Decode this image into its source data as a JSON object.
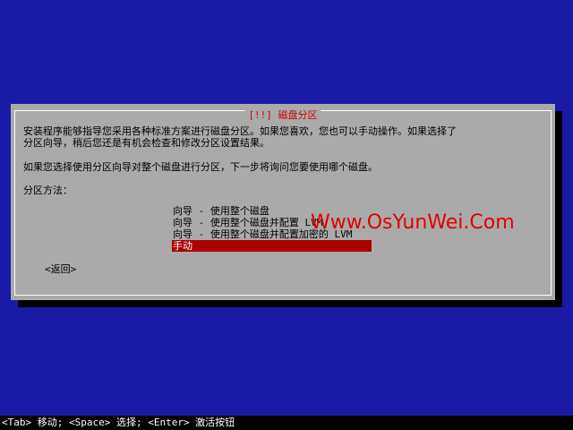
{
  "dialog": {
    "title": "[!!] 磁盘分区",
    "intro_line1": "安装程序能够指导您采用各种标准方案进行磁盘分区。如果您喜欢，您也可以手动操作。如果选择了",
    "intro_line2": "分区向导，稍后您还是有机会检查和修改分区设置结果。",
    "question": "如果您选择使用分区向导对整个磁盘进行分区，下一步将询问您要使用哪个磁盘。",
    "method_label": "分区方法：",
    "options": [
      {
        "label": "向导 - 使用整个磁盘",
        "selected": false
      },
      {
        "label": "向导 - 使用整个磁盘并配置 LVM",
        "selected": false
      },
      {
        "label": "向导 - 使用整个磁盘并配置加密的 LVM",
        "selected": false
      },
      {
        "label": "手动",
        "selected": true
      }
    ],
    "back_button": "<返回>"
  },
  "watermark": "Www.OsYunWei.Com",
  "statusbar": "<Tab> 移动; <Space> 选择; <Enter> 激活按钮",
  "colors": {
    "background": "#1a1aa6",
    "dialog": "#aaaaaa",
    "title": "#cc0000",
    "selected": "#aa0000",
    "watermark": "#e00000"
  }
}
